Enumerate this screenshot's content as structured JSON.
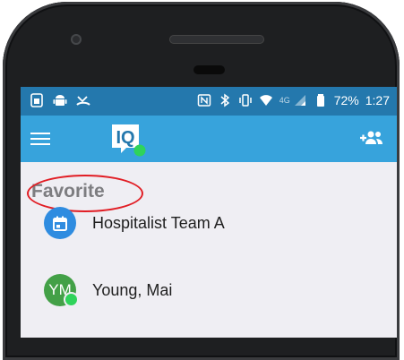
{
  "statusbar": {
    "left_icons": [
      "sim-icon",
      "android-icon",
      "missed-call-icon"
    ],
    "right_icons": [
      "nfc-icon",
      "bluetooth-icon",
      "vibrate-icon",
      "wifi-icon",
      "signal-icon",
      "battery-icon"
    ],
    "network": "4G",
    "battery": "72%",
    "time": "1:27"
  },
  "appbar": {
    "menu_icon": "hamburger-menu-icon",
    "logo_text": "IQ",
    "add_icon": "add-contact-icon"
  },
  "section": {
    "title": "Favorite"
  },
  "favorites": [
    {
      "label": "Hospitalist Team A",
      "avatar_type": "calendar-icon",
      "avatar_color": "#2f8ce0"
    },
    {
      "label": "Young, Mai",
      "initials": "YM",
      "avatar_color": "#43a047",
      "online": true
    }
  ],
  "colors": {
    "statusbar": "#2478ad",
    "appbar": "#37a3dc",
    "annotation": "#e11d24",
    "online": "#2fd35a"
  }
}
